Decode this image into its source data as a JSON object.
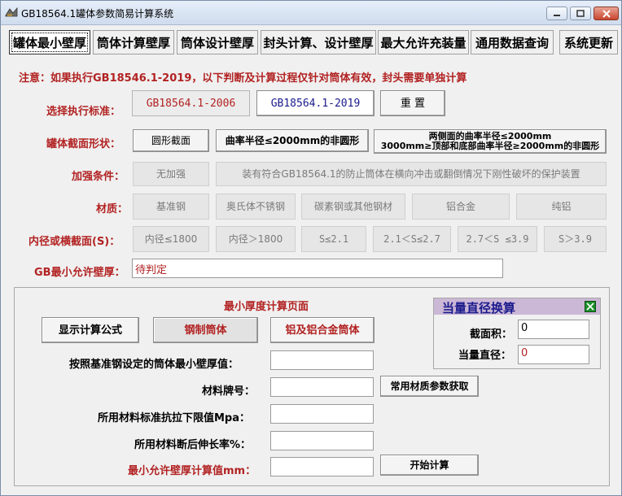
{
  "window": {
    "title": "GB18564.1罐体参数简易计算系统"
  },
  "tabs": [
    "罐体最小壁厚",
    "筒体计算壁厚",
    "筒体设计壁厚",
    "封头计算、设计壁厚",
    "最大允许充装量",
    "通用数据查询",
    "系统更新"
  ],
  "notice": "注意：如果执行GB18546.1-2019，以下判断及计算过程仅针对筒体有效，封头需要单独计算",
  "standard": {
    "label": "选择执行标准：",
    "opt1": "GB18564.1-2006",
    "opt2": "GB18564.1-2019",
    "reset": "重 置"
  },
  "shape": {
    "label": "罐体截面形状：",
    "opt1": "圆形截面",
    "opt2": "曲率半径≤2000mm的非圆形",
    "opt3_line1": "两侧面的曲率半径≤2000mm",
    "opt3_line2": "3000mm≥顶部和底部曲率半径≥2000mm的非圆形"
  },
  "reinforce": {
    "label": "加强条件：",
    "opt1": "无加强",
    "opt2": "装有符合GB18564.1的防止筒体在横向冲击或翻倒情况下刚性破坏的保护装置"
  },
  "material": {
    "label": "材质：",
    "options": [
      "基准钢",
      "奥氏体不锈钢",
      "碳素钢或其他钢材",
      "铝合金",
      "纯铝"
    ]
  },
  "diameter": {
    "label": "内径或横截面(S)：",
    "options": [
      "内径≤1800",
      "内径＞1800",
      "S≤2.1",
      "2.1＜S≤2.7",
      "2.7＜S ≤3.9",
      "S＞3.9"
    ]
  },
  "gb_min": {
    "label": "GB最小允许壁厚：",
    "value": "待判定"
  },
  "calc": {
    "title": "最小厚度计算页面",
    "show_formula": "显示计算公式",
    "steel_tank": "钢制筒体",
    "al_tank": "铝及铝合金筒体",
    "row1": "按照基准钢设定的筒体最小壁厚值：",
    "row2": "材料牌号：",
    "row3": "所用材料标准抗拉下限值Mpa：",
    "row4": "所用材料断后伸长率%：",
    "row5": "最小允许壁厚计算值mm：",
    "get_params": "常用材质参数获取",
    "start": "开始计算"
  },
  "converter": {
    "title": "当量直径换算",
    "area_label": "截面积：",
    "area_value": "0",
    "eq_label": "当量直径：",
    "eq_value": "0"
  },
  "colors": {
    "label_red": "#b22222",
    "blue_text": "#1a1a8c",
    "converter_header": "#cbb7d6",
    "close_btn": "#c8452e"
  }
}
